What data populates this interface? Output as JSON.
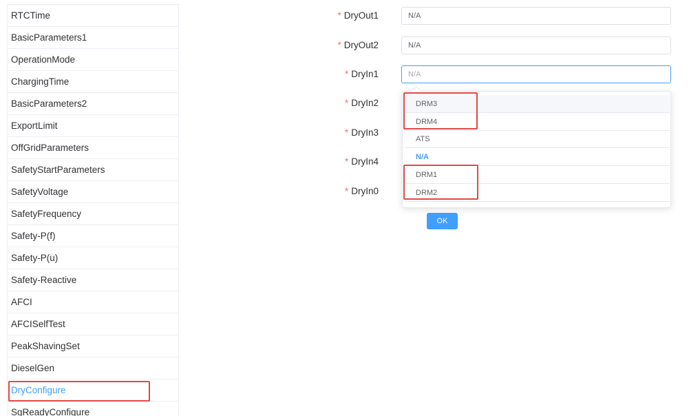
{
  "sidebar": {
    "items": [
      {
        "label": "RTCTime"
      },
      {
        "label": "BasicParameters1"
      },
      {
        "label": "OperationMode"
      },
      {
        "label": "ChargingTime"
      },
      {
        "label": "BasicParameters2"
      },
      {
        "label": "ExportLimit"
      },
      {
        "label": "OffGridParameters"
      },
      {
        "label": "SafetyStartParameters"
      },
      {
        "label": "SafetyVoltage"
      },
      {
        "label": "SafetyFrequency"
      },
      {
        "label": "Safety-P(f)"
      },
      {
        "label": "Safety-P(u)"
      },
      {
        "label": "Safety-Reactive"
      },
      {
        "label": "AFCI"
      },
      {
        "label": "AFCISelfTest"
      },
      {
        "label": "PeakShavingSet"
      },
      {
        "label": "DieselGen"
      },
      {
        "label": "DryConfigure"
      },
      {
        "label": "SgReadyConfigure"
      }
    ],
    "active_item": "DryConfigure"
  },
  "form": {
    "required_mark": "*",
    "fields": [
      {
        "label": "DryOut1",
        "value": "N/A"
      },
      {
        "label": "DryOut2",
        "value": "N/A"
      },
      {
        "label": "DryIn1",
        "value": "",
        "placeholder": "N/A"
      },
      {
        "label": "DryIn2"
      },
      {
        "label": "DryIn3"
      },
      {
        "label": "DryIn4"
      },
      {
        "label": "DryIn0"
      }
    ]
  },
  "dropdown": {
    "options": [
      {
        "label": "DRM3"
      },
      {
        "label": "DRM4"
      },
      {
        "label": "ATS"
      },
      {
        "label": "N/A"
      },
      {
        "label": "DRM1"
      },
      {
        "label": "DRM2"
      }
    ],
    "selected": "N/A",
    "hovered": "DRM3"
  },
  "ok_button": {
    "label": "OK"
  },
  "colors": {
    "accent": "#409eff",
    "required": "#f56c6c",
    "highlight_box": "#e04747"
  }
}
